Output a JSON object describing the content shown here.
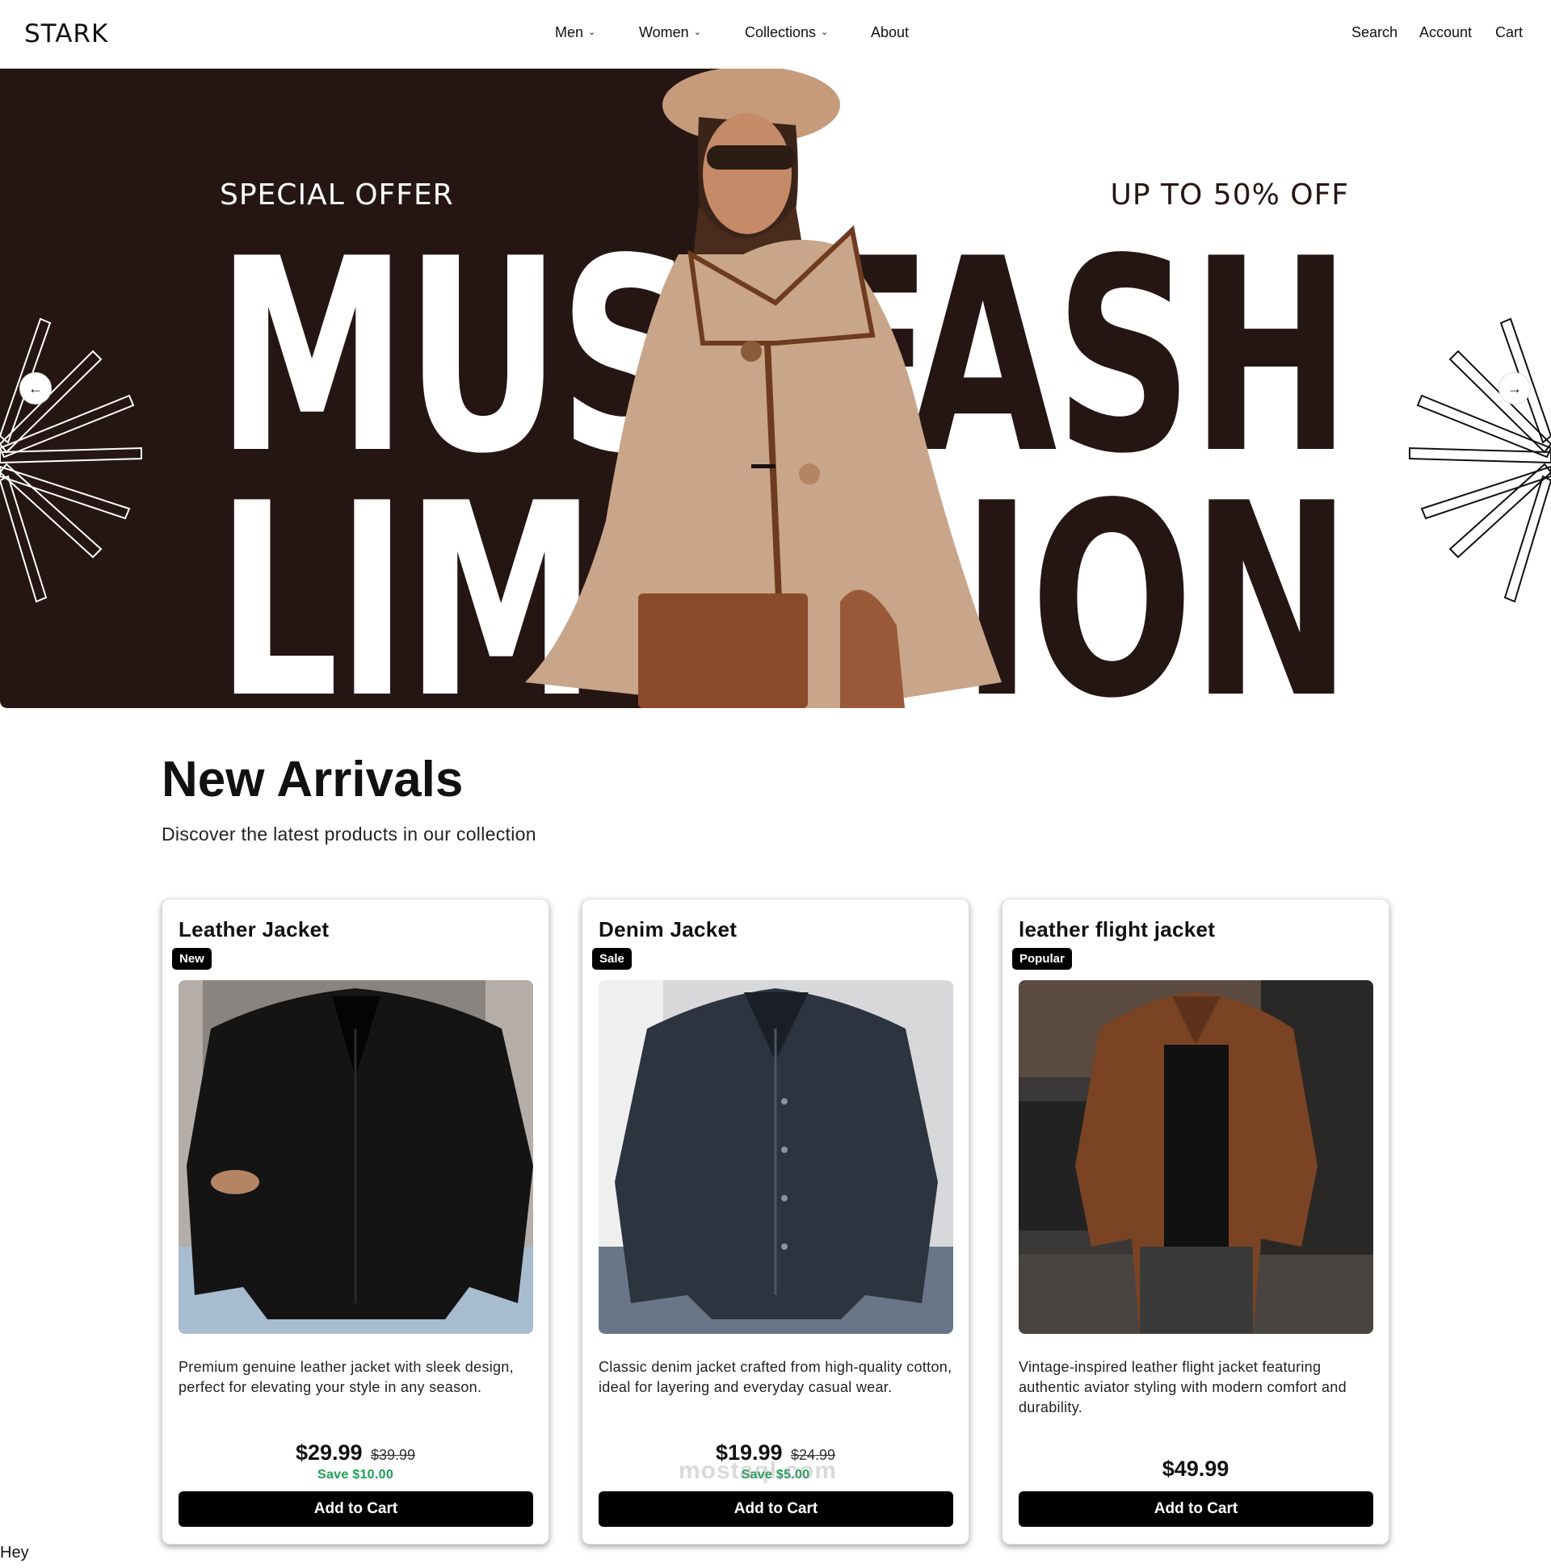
{
  "header": {
    "logo": "STARK",
    "nav": [
      {
        "label": "Men",
        "has_dropdown": true
      },
      {
        "label": "Women",
        "has_dropdown": true
      },
      {
        "label": "Collections",
        "has_dropdown": true
      },
      {
        "label": "About",
        "has_dropdown": false
      }
    ],
    "utility": {
      "search": "Search",
      "account": "Account",
      "cart": "Cart"
    }
  },
  "hero": {
    "left_tag": "SPECIAL OFFER",
    "right_tag": "UP TO 50% OFF",
    "left_line1": "MUS",
    "left_line2": "LIM",
    "right_line1": "FASH",
    "right_line2": "ION",
    "prev_icon": "←",
    "next_icon": "→",
    "colors": {
      "dark": "#251614",
      "light": "#ffffff"
    }
  },
  "arrivals": {
    "title": "New Arrivals",
    "subtitle": "Discover the latest products in our collection",
    "products": [
      {
        "name": "Leather Jacket",
        "badge": "New",
        "description": "Premium genuine leather jacket with sleek design, perfect for elevating your style in any season.",
        "price": "$29.99",
        "old_price": "$39.99",
        "save": "Save $10.00",
        "button": "Add to Cart"
      },
      {
        "name": "Denim Jacket",
        "badge": "Sale",
        "description": "Classic denim jacket crafted from high-quality cotton, ideal for layering and everyday casual wear.",
        "price": "$19.99",
        "old_price": "$24.99",
        "save": "Save $5.00",
        "button": "Add to Cart"
      },
      {
        "name": "leather flight jacket",
        "badge": "Popular",
        "description": "Vintage-inspired leather flight jacket featuring authentic aviator styling with modern comfort and durability.",
        "price": "$49.99",
        "old_price": "",
        "save": "",
        "button": "Add to Cart"
      }
    ]
  },
  "footer_text": "Hey",
  "watermark": "mostaql.com"
}
